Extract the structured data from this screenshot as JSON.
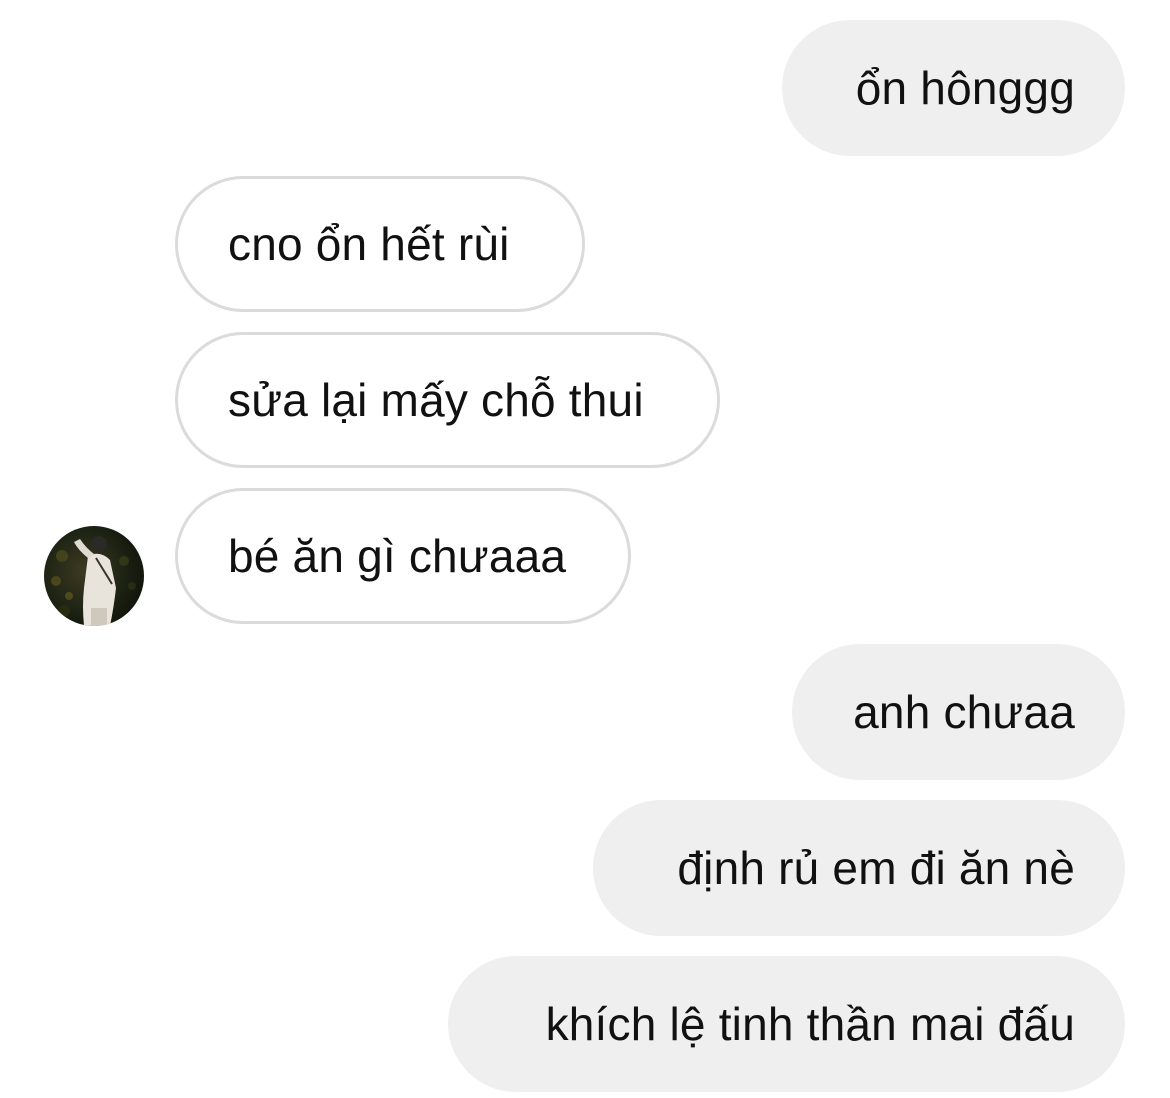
{
  "conversation": {
    "messages": [
      {
        "direction": "outgoing",
        "text": "ổn hônggg"
      },
      {
        "direction": "incoming",
        "text": "cno ổn hết rùi"
      },
      {
        "direction": "incoming",
        "text": "sửa lại mấy chỗ thui"
      },
      {
        "direction": "incoming",
        "text": "bé ăn gì chưaaa"
      },
      {
        "direction": "outgoing",
        "text": "anh chưaa"
      },
      {
        "direction": "outgoing",
        "text": "định rủ em đi ăn nè"
      },
      {
        "direction": "outgoing",
        "text": "khích lệ tinh thần mai đấu"
      }
    ]
  },
  "colors": {
    "outgoing_bubble": "#efefef",
    "incoming_border": "#dbdbdb",
    "text": "#111111"
  },
  "icons": {
    "avatar": "contact-profile-photo"
  }
}
